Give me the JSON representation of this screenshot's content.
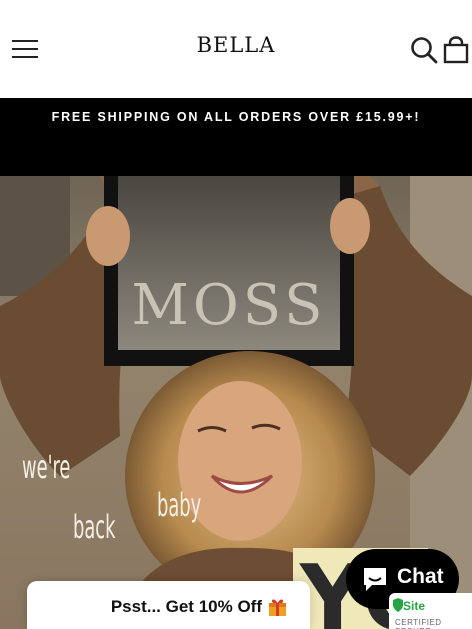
{
  "header": {
    "logo_text": "BELLA",
    "menu_icon": "hamburger-menu-icon",
    "search_icon": "search-icon",
    "cart_icon": "cart-icon"
  },
  "announcement": {
    "text": "FREE SHIPPING ON ALL ORDERS OVER £15.99+!"
  },
  "hero": {
    "frame_print": "MOSS",
    "overlay_words": [
      "we're",
      "back",
      "baby"
    ]
  },
  "promo": {
    "text": "Psst... Get 10% Off",
    "icon": "gift-icon"
  },
  "chat": {
    "label": "Chat",
    "icon": "chat-bubble-icon"
  },
  "trust_badge": {
    "name": "Site",
    "subtitle": "CERTIFIED SECURE"
  },
  "colors": {
    "announce_bg": "#000000",
    "chat_bg": "#000000",
    "trust_green": "#27a545"
  }
}
